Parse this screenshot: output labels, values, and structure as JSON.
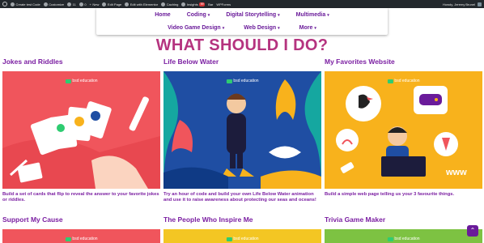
{
  "adminbar": {
    "items": [
      "Create test Code",
      "Customize",
      "11",
      "0",
      "New",
      "Edit Page",
      "Edit with Elementor",
      "Caching",
      "Insights",
      "Bar",
      "WPForms"
    ],
    "insights_badge": "59",
    "user": "Howdy, Jeremy Brunel"
  },
  "nav": {
    "row1": [
      {
        "label": "Home",
        "has_caret": false
      },
      {
        "label": "Coding",
        "has_caret": true
      },
      {
        "label": "Digital Storytelling",
        "has_caret": true
      },
      {
        "label": "Multimedia",
        "has_caret": true
      }
    ],
    "row2": [
      {
        "label": "Video Game Design",
        "has_caret": true
      },
      {
        "label": "Web Design",
        "has_caret": true
      },
      {
        "label": "More",
        "has_caret": true
      }
    ]
  },
  "headline": "WHAT SHOULD I DO?",
  "brand_text": "bsd education",
  "cards": [
    {
      "title": "Jokes and Riddles",
      "desc": "Build a set of cards that flip to reveal the answer to your favorite jokes or riddles.",
      "color": "#f0555c"
    },
    {
      "title": "Life Below Water",
      "desc": "Try an hour of code and build your own Life Below Water animation and use it to raise awareness about protecting our seas and oceans!",
      "color": "#1f4ea3"
    },
    {
      "title": "My Favorites Website",
      "desc": "Build a simple web page telling us your 3 favourite things.",
      "color": "#f8b21c"
    },
    {
      "title": "Support My Cause",
      "desc": "",
      "color": "#f0555c"
    },
    {
      "title": "The People Who Inspire Me",
      "desc": "",
      "color": "#f3c623"
    },
    {
      "title": "Trivia Game Maker",
      "desc": "",
      "color": "#7dc242"
    }
  ],
  "scroll_top_icon": "chevron-up-icon"
}
